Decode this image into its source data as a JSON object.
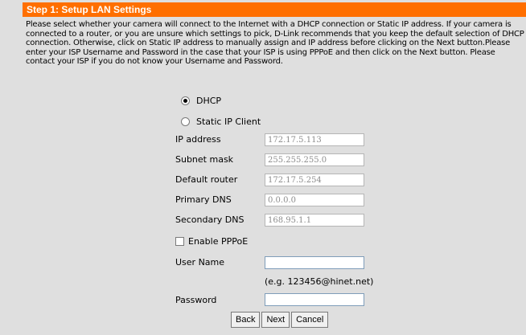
{
  "header": {
    "title": "Step 1: Setup LAN Settings"
  },
  "description": "Please select whether your camera will connect to the Internet with a DHCP connection or Static IP address. If your camera is connected to a router, or you are unsure which settings to pick, D-Link recommends that you keep the default selection of DHCP connection. Otherwise, click on Static IP address to manually assign and IP address before clicking on the Next button.Please enter your ISP Username and Password in the case that your ISP is using PPPoE and then click on the Next button. Please contact your ISP if you do not know your Username and Password.",
  "mode": {
    "dhcp_label": "DHCP",
    "static_label": "Static IP Client",
    "selected": "DHCP"
  },
  "fields": {
    "ip_label": "IP address",
    "ip_value": "172.17.5.113",
    "mask_label": "Subnet mask",
    "mask_value": "255.255.255.0",
    "router_label": "Default router",
    "router_value": "172.17.5.254",
    "dns1_label": "Primary DNS",
    "dns1_value": "0.0.0.0",
    "dns2_label": "Secondary DNS",
    "dns2_value": "168.95.1.1"
  },
  "pppoe": {
    "enable_label": "Enable PPPoE",
    "username_label": "User Name",
    "username_value": "",
    "example": "(e.g. 123456@hinet.net)",
    "password_label": "Password",
    "password_value": ""
  },
  "buttons": {
    "back": "Back",
    "next": "Next",
    "cancel": "Cancel"
  }
}
